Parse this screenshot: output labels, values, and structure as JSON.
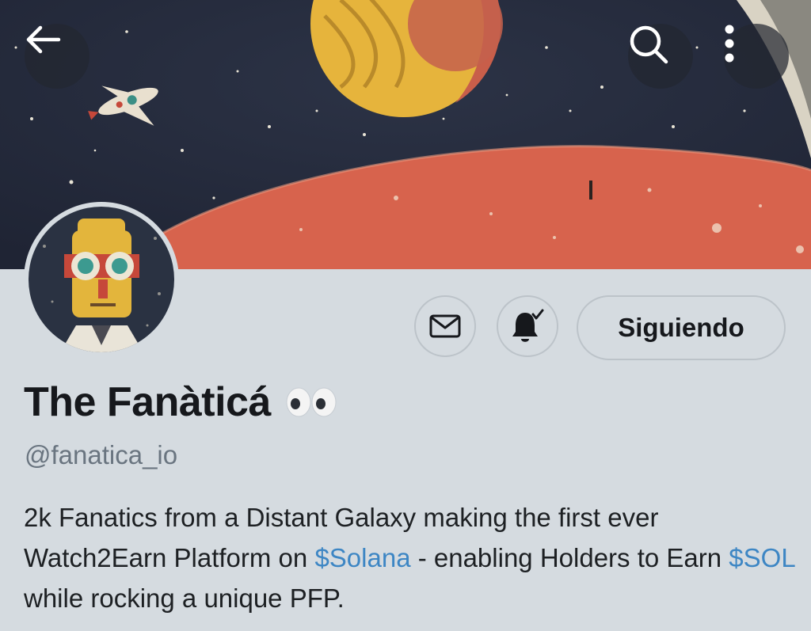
{
  "header": {
    "back_icon": "arrow-left-icon",
    "search_icon": "search-icon",
    "more_icon": "more-vertical-icon"
  },
  "banner": {
    "description_colors": {
      "sky": "#262c3e",
      "planet": "#d7634d",
      "moon": "#e6b43c"
    }
  },
  "actions": {
    "message_icon": "envelope-icon",
    "notifications_icon": "bell-check-icon",
    "follow_label": "Siguiendo"
  },
  "profile": {
    "display_name": "The Fanàticá",
    "name_emoji": "👀",
    "handle": "@fanatica_io",
    "bio": {
      "part1": "2k Fanatics from a Distant Galaxy making the first ever Watch2Earn Platform on ",
      "link1": "$Solana",
      "part2": " - enabling Holders to Earn ",
      "link2": "$SOL",
      "part3": " while rocking a unique PFP."
    }
  },
  "colors": {
    "background": "#d5dbe0",
    "text": "#16181c",
    "secondary_text": "#6a7580",
    "link": "#3d86c4",
    "border": "#bcc3c9"
  }
}
